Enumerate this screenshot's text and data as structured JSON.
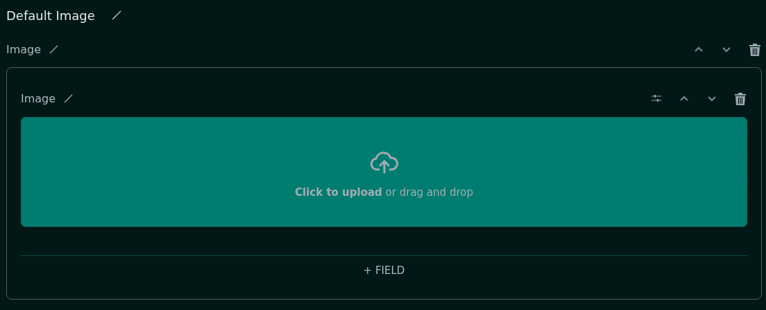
{
  "title": "Default Image",
  "section": {
    "label": "Image",
    "field": {
      "label": "Image",
      "upload": {
        "text": "**Click to upload** or drag and drop"
      }
    },
    "add_button": "+ FIELD"
  }
}
